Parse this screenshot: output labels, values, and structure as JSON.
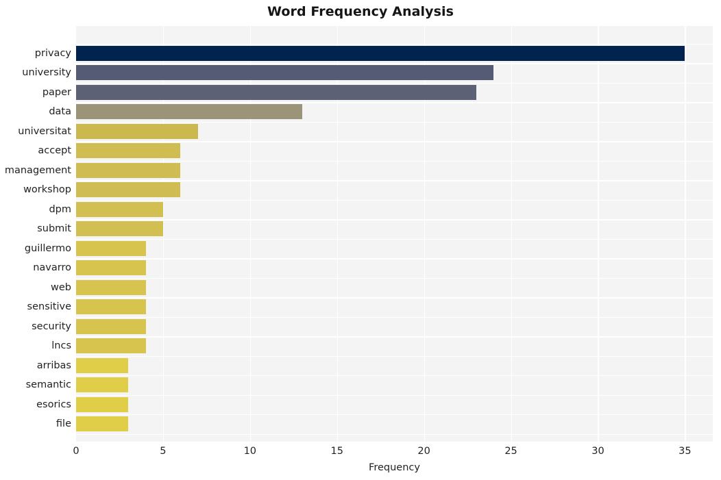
{
  "chart_data": {
    "type": "bar",
    "orientation": "horizontal",
    "title": "Word Frequency Analysis",
    "xlabel": "Frequency",
    "ylabel": "",
    "categories": [
      "privacy",
      "university",
      "paper",
      "data",
      "universitat",
      "accept",
      "management",
      "workshop",
      "dpm",
      "submit",
      "guillermo",
      "navarro",
      "web",
      "sensitive",
      "security",
      "lncs",
      "arribas",
      "semantic",
      "esorics",
      "file"
    ],
    "values": [
      35,
      24,
      23,
      13,
      7,
      6,
      6,
      6,
      5,
      5,
      4,
      4,
      4,
      4,
      4,
      4,
      3,
      3,
      3,
      3
    ],
    "bar_colors": [
      "#00244d",
      "#555b74",
      "#5c6175",
      "#9b9478",
      "#cbb84f",
      "#cfbc52",
      "#cfbc52",
      "#cfbc52",
      "#d2bf52",
      "#d2bf52",
      "#d6c44f",
      "#d6c44f",
      "#d6c44f",
      "#d6c44f",
      "#d6c44f",
      "#d6c44f",
      "#e0ce48",
      "#e0ce48",
      "#e0ce48",
      "#e0ce48"
    ],
    "xlim": [
      0,
      36.6
    ],
    "xticks": [
      0,
      5,
      10,
      15,
      20,
      25,
      30,
      35
    ],
    "xticklabels": [
      "0",
      "5",
      "10",
      "15",
      "20",
      "25",
      "30",
      "35"
    ],
    "grid": true,
    "grid_color": "#ffffff",
    "plot_background": "#f4f4f5",
    "figure_background": "#ffffff",
    "legend": null
  }
}
